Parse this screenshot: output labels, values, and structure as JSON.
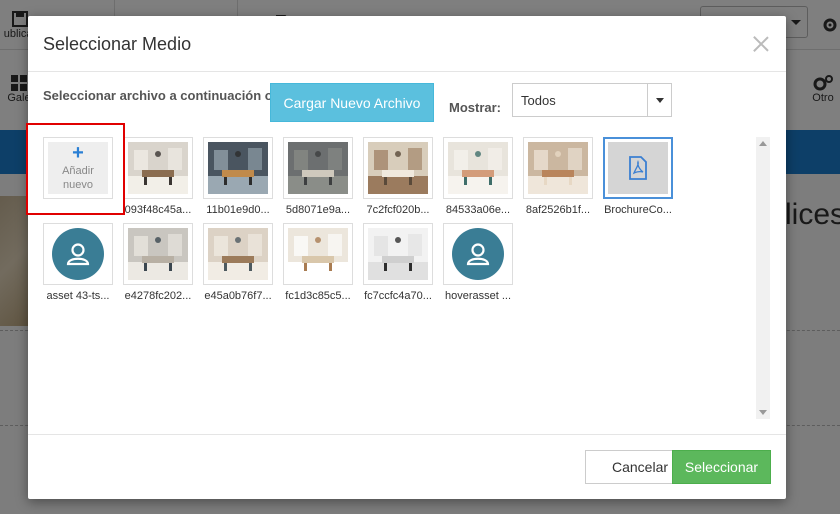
{
  "background": {
    "toolbar": {
      "publish_label": "ublicar",
      "gallery_label": "Gale",
      "other_label": "Otro"
    },
    "heading_fragment": "lices"
  },
  "modal": {
    "title": "Seleccionar Medio",
    "instruction": "Seleccionar archivo a continuación o",
    "upload_button": "Cargar Nuevo Archivo",
    "filter_label": "Mostrar:",
    "filter_value": "Todos",
    "add_new": {
      "line1": "Añadir",
      "line2": "nuevo"
    },
    "items": [
      {
        "label": "093f48c45a...",
        "type": "photo"
      },
      {
        "label": "11b01e9d0...",
        "type": "photo"
      },
      {
        "label": "5d8071e9a...",
        "type": "photo"
      },
      {
        "label": "7c2fcf020b...",
        "type": "photo"
      },
      {
        "label": "84533a06e...",
        "type": "photo"
      },
      {
        "label": "8af2526b1f...",
        "type": "photo"
      },
      {
        "label": "BrochureCo...",
        "type": "pdf",
        "selected": true
      },
      {
        "label": "asset 43-ts...",
        "type": "avatar"
      },
      {
        "label": "e4278fc202...",
        "type": "photo"
      },
      {
        "label": "e45a0b76f7...",
        "type": "photo"
      },
      {
        "label": "fc1d3c85c5...",
        "type": "photo"
      },
      {
        "label": "fc7ccfc4a70...",
        "type": "photo"
      },
      {
        "label": "hoverasset ...",
        "type": "avatar"
      }
    ],
    "cancel_button": "Cancelar",
    "select_button": "Seleccionar"
  },
  "colors": {
    "upload_button": "#5bc0de",
    "select_button": "#5cb85c",
    "highlight_box": "#e00000",
    "avatar": "#3a7d95",
    "selected_border": "#4a90d9",
    "background_band": "#1a7fd1"
  },
  "icons": [
    "close-icon",
    "plus-icon",
    "pdf-icon",
    "user-icon",
    "chevron-down-icon"
  ]
}
